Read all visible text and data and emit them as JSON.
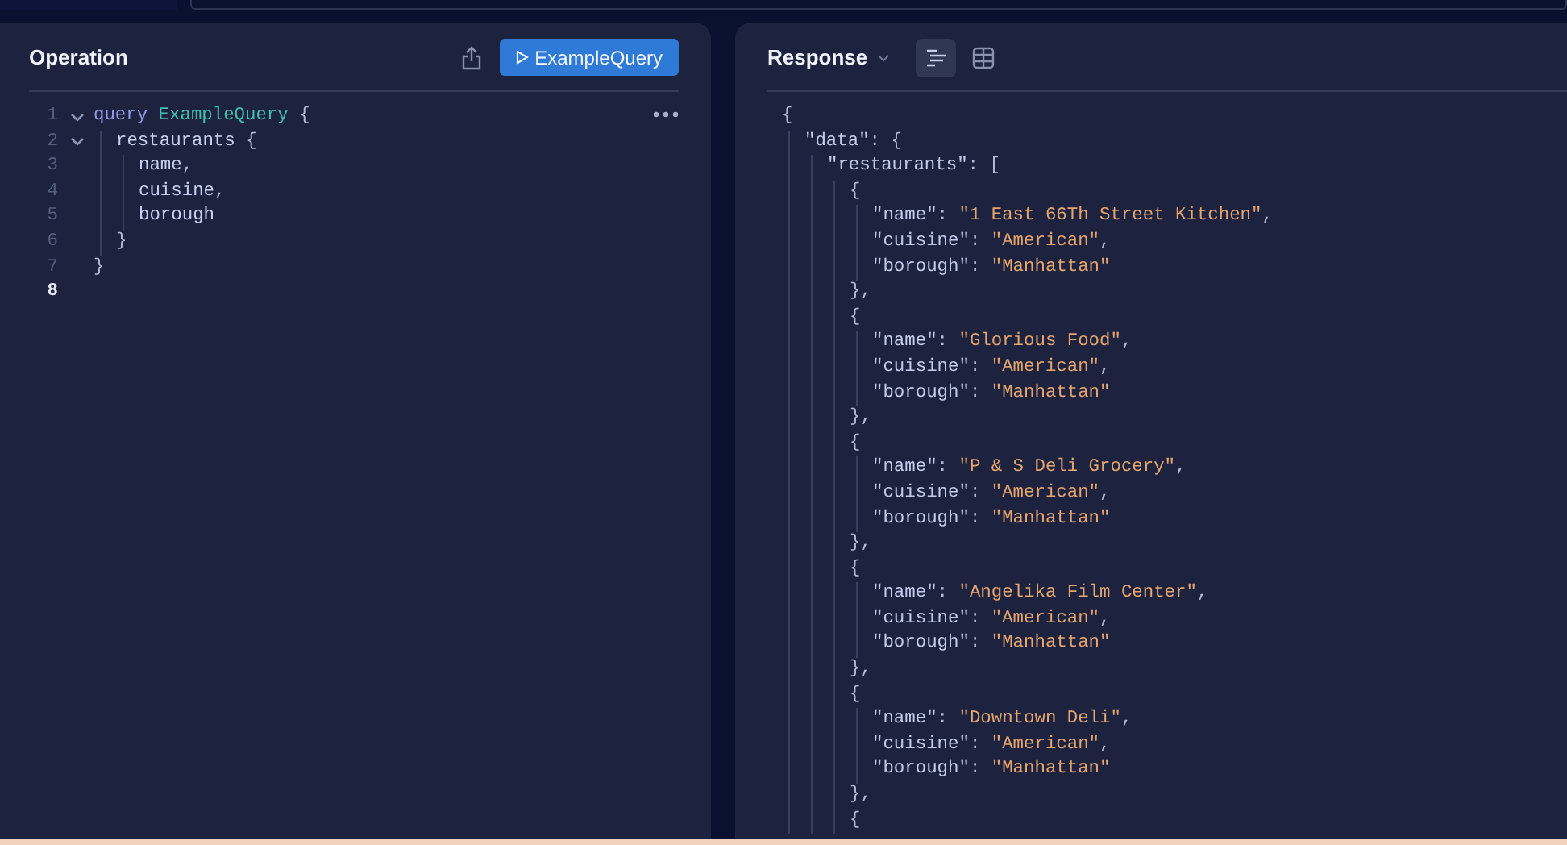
{
  "operation": {
    "title": "Operation",
    "run_button": {
      "label": "ExampleQuery"
    },
    "lines": [
      {
        "number": "1",
        "current": false,
        "expanded": true,
        "tokens": [
          {
            "kind": "keyword",
            "text": "query "
          },
          {
            "kind": "name",
            "text": "ExampleQuery"
          },
          {
            "kind": "punct",
            "text": " {"
          }
        ],
        "children": [
          {
            "number": "2",
            "current": false,
            "expanded": true,
            "tokens": [
              {
                "kind": "field",
                "text": "restaurants"
              },
              {
                "kind": "punct",
                "text": " {"
              }
            ],
            "children": [
              {
                "number": "3",
                "current": false,
                "tokens": [
                  {
                    "kind": "field",
                    "text": "name"
                  },
                  {
                    "kind": "punct",
                    "text": ","
                  }
                ]
              },
              {
                "number": "4",
                "current": false,
                "tokens": [
                  {
                    "kind": "field",
                    "text": "cuisine"
                  },
                  {
                    "kind": "punct",
                    "text": ","
                  }
                ]
              },
              {
                "number": "5",
                "current": false,
                "tokens": [
                  {
                    "kind": "field",
                    "text": "borough"
                  }
                ]
              }
            ],
            "close": {
              "number": "6",
              "current": false,
              "tokens": [
                {
                  "kind": "punct",
                  "text": "}"
                }
              ]
            }
          }
        ],
        "close": {
          "number": "7",
          "current": false,
          "tokens": [
            {
              "kind": "punct",
              "text": "}"
            }
          ]
        }
      },
      {
        "number": "8",
        "current": true
      }
    ]
  },
  "response": {
    "title": "Response",
    "views": [
      {
        "kind": "list",
        "selected": true
      },
      {
        "kind": "table",
        "selected": false
      }
    ],
    "lines": [
      {
        "tokens": [
          {
            "kind": "punct",
            "text": "{"
          }
        ],
        "children": [
          {
            "tokens": [
              {
                "kind": "key",
                "text": "\"data\""
              },
              {
                "kind": "punct",
                "text": ": {"
              }
            ],
            "children": [
              {
                "tokens": [
                  {
                    "kind": "key",
                    "text": "\"restaurants\""
                  },
                  {
                    "kind": "punct",
                    "text": ": ["
                  }
                ],
                "children": [
                  {
                    "tokens": [
                      {
                        "kind": "punct",
                        "text": "{"
                      }
                    ],
                    "children": [
                      {
                        "tokens": [
                          {
                            "kind": "key",
                            "text": "\"name\""
                          },
                          {
                            "kind": "punct",
                            "text": ": "
                          },
                          {
                            "kind": "string",
                            "text": "\"1 East 66Th Street Kitchen\""
                          },
                          {
                            "kind": "punct",
                            "text": ","
                          }
                        ]
                      },
                      {
                        "tokens": [
                          {
                            "kind": "key",
                            "text": "\"cuisine\""
                          },
                          {
                            "kind": "punct",
                            "text": ": "
                          },
                          {
                            "kind": "string",
                            "text": "\"American\""
                          },
                          {
                            "kind": "punct",
                            "text": ","
                          }
                        ]
                      },
                      {
                        "tokens": [
                          {
                            "kind": "key",
                            "text": "\"borough\""
                          },
                          {
                            "kind": "punct",
                            "text": ": "
                          },
                          {
                            "kind": "string",
                            "text": "\"Manhattan\""
                          }
                        ]
                      }
                    ],
                    "close": {
                      "tokens": [
                        {
                          "kind": "punct",
                          "text": "},"
                        }
                      ]
                    }
                  },
                  {
                    "tokens": [
                      {
                        "kind": "punct",
                        "text": "{"
                      }
                    ],
                    "children": [
                      {
                        "tokens": [
                          {
                            "kind": "key",
                            "text": "\"name\""
                          },
                          {
                            "kind": "punct",
                            "text": ": "
                          },
                          {
                            "kind": "string",
                            "text": "\"Glorious Food\""
                          },
                          {
                            "kind": "punct",
                            "text": ","
                          }
                        ]
                      },
                      {
                        "tokens": [
                          {
                            "kind": "key",
                            "text": "\"cuisine\""
                          },
                          {
                            "kind": "punct",
                            "text": ": "
                          },
                          {
                            "kind": "string",
                            "text": "\"American\""
                          },
                          {
                            "kind": "punct",
                            "text": ","
                          }
                        ]
                      },
                      {
                        "tokens": [
                          {
                            "kind": "key",
                            "text": "\"borough\""
                          },
                          {
                            "kind": "punct",
                            "text": ": "
                          },
                          {
                            "kind": "string",
                            "text": "\"Manhattan\""
                          }
                        ]
                      }
                    ],
                    "close": {
                      "tokens": [
                        {
                          "kind": "punct",
                          "text": "},"
                        }
                      ]
                    }
                  },
                  {
                    "tokens": [
                      {
                        "kind": "punct",
                        "text": "{"
                      }
                    ],
                    "children": [
                      {
                        "tokens": [
                          {
                            "kind": "key",
                            "text": "\"name\""
                          },
                          {
                            "kind": "punct",
                            "text": ": "
                          },
                          {
                            "kind": "string",
                            "text": "\"P & S Deli Grocery\""
                          },
                          {
                            "kind": "punct",
                            "text": ","
                          }
                        ]
                      },
                      {
                        "tokens": [
                          {
                            "kind": "key",
                            "text": "\"cuisine\""
                          },
                          {
                            "kind": "punct",
                            "text": ": "
                          },
                          {
                            "kind": "string",
                            "text": "\"American\""
                          },
                          {
                            "kind": "punct",
                            "text": ","
                          }
                        ]
                      },
                      {
                        "tokens": [
                          {
                            "kind": "key",
                            "text": "\"borough\""
                          },
                          {
                            "kind": "punct",
                            "text": ": "
                          },
                          {
                            "kind": "string",
                            "text": "\"Manhattan\""
                          }
                        ]
                      }
                    ],
                    "close": {
                      "tokens": [
                        {
                          "kind": "punct",
                          "text": "},"
                        }
                      ]
                    }
                  },
                  {
                    "tokens": [
                      {
                        "kind": "punct",
                        "text": "{"
                      }
                    ],
                    "children": [
                      {
                        "tokens": [
                          {
                            "kind": "key",
                            "text": "\"name\""
                          },
                          {
                            "kind": "punct",
                            "text": ": "
                          },
                          {
                            "kind": "string",
                            "text": "\"Angelika Film Center\""
                          },
                          {
                            "kind": "punct",
                            "text": ","
                          }
                        ]
                      },
                      {
                        "tokens": [
                          {
                            "kind": "key",
                            "text": "\"cuisine\""
                          },
                          {
                            "kind": "punct",
                            "text": ": "
                          },
                          {
                            "kind": "string",
                            "text": "\"American\""
                          },
                          {
                            "kind": "punct",
                            "text": ","
                          }
                        ]
                      },
                      {
                        "tokens": [
                          {
                            "kind": "key",
                            "text": "\"borough\""
                          },
                          {
                            "kind": "punct",
                            "text": ": "
                          },
                          {
                            "kind": "string",
                            "text": "\"Manhattan\""
                          }
                        ]
                      }
                    ],
                    "close": {
                      "tokens": [
                        {
                          "kind": "punct",
                          "text": "},"
                        }
                      ]
                    }
                  },
                  {
                    "tokens": [
                      {
                        "kind": "punct",
                        "text": "{"
                      }
                    ],
                    "children": [
                      {
                        "tokens": [
                          {
                            "kind": "key",
                            "text": "\"name\""
                          },
                          {
                            "kind": "punct",
                            "text": ": "
                          },
                          {
                            "kind": "string",
                            "text": "\"Downtown Deli\""
                          },
                          {
                            "kind": "punct",
                            "text": ","
                          }
                        ]
                      },
                      {
                        "tokens": [
                          {
                            "kind": "key",
                            "text": "\"cuisine\""
                          },
                          {
                            "kind": "punct",
                            "text": ": "
                          },
                          {
                            "kind": "string",
                            "text": "\"American\""
                          },
                          {
                            "kind": "punct",
                            "text": ","
                          }
                        ]
                      },
                      {
                        "tokens": [
                          {
                            "kind": "key",
                            "text": "\"borough\""
                          },
                          {
                            "kind": "punct",
                            "text": ": "
                          },
                          {
                            "kind": "string",
                            "text": "\"Manhattan\""
                          }
                        ]
                      }
                    ],
                    "close": {
                      "tokens": [
                        {
                          "kind": "punct",
                          "text": "},"
                        }
                      ]
                    }
                  },
                  {
                    "tokens": [
                      {
                        "kind": "punct",
                        "text": "{"
                      }
                    ]
                  }
                ]
              }
            ]
          }
        ]
      }
    ]
  }
}
